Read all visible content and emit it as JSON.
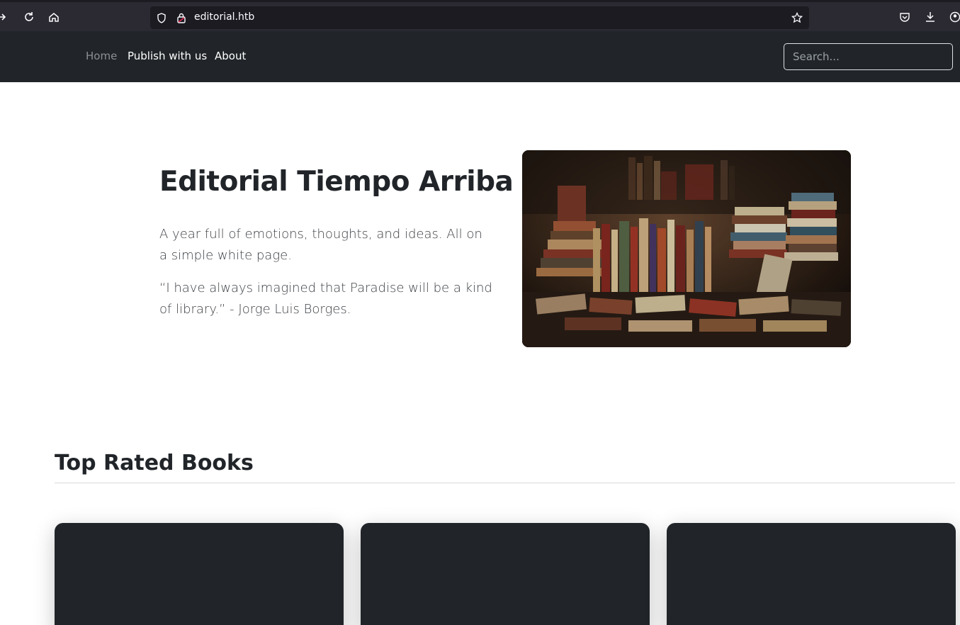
{
  "browser": {
    "url": "editorial.htb"
  },
  "navbar": {
    "links": [
      {
        "label": "Home",
        "state": "muted"
      },
      {
        "label": "Publish with us",
        "state": "active"
      },
      {
        "label": "About",
        "state": "active"
      }
    ],
    "search": {
      "placeholder": "Search...",
      "value": ""
    }
  },
  "hero": {
    "title": "Editorial Tiempo Arriba",
    "paragraph": "A year full of emotions, thoughts, and ideas. All on a simple white page.",
    "quote": "“I have always imagined that Paradise will be a kind of library.” - Jorge Luis Borges."
  },
  "section": {
    "title": "Top Rated Books"
  },
  "colors": {
    "navbar_bg": "#212529",
    "browser_bg": "#2b2a33",
    "card_bg": "#212529"
  }
}
